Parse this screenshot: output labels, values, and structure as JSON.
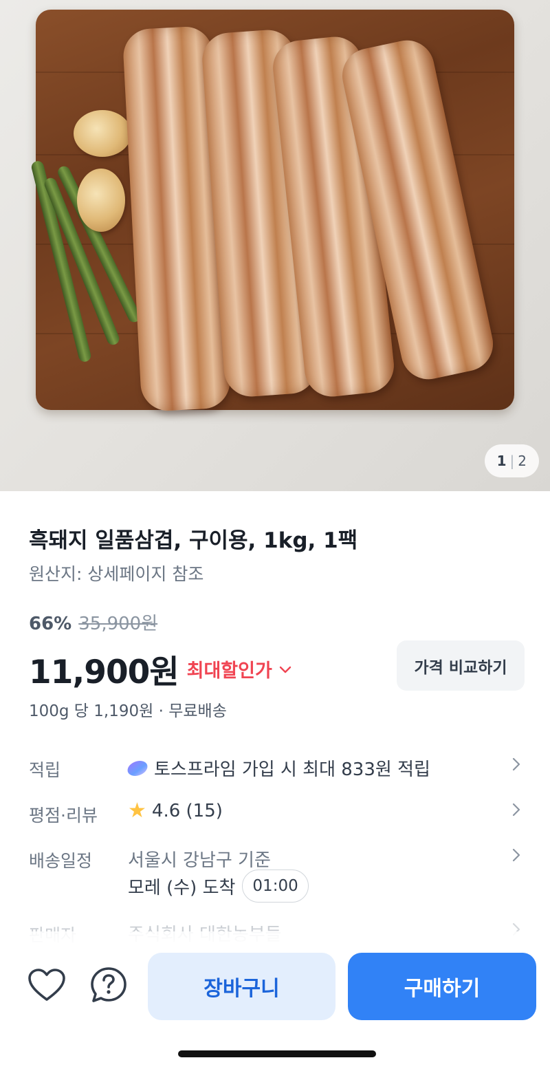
{
  "gallery": {
    "image_description_icon": "pork-belly-photo",
    "current": "1",
    "separator": "|",
    "total": "2"
  },
  "product": {
    "title": "흑돼지 일품삼겹, 구이용, 1kg, 1팩",
    "origin": "원산지: 상세페이지 참조",
    "discount_rate": "66%",
    "original_price": "35,900원",
    "price": "11,900원",
    "price_tag": "최대할인가",
    "compare_label": "가격 비교하기",
    "unit_price": "100g 당 1,190원 · 무료배송"
  },
  "details": {
    "points": {
      "label": "적립",
      "value": "토스프라임 가입 시 최대 833원 적립",
      "icon": "toss-prime-icon"
    },
    "rating": {
      "label": "평점·리뷰",
      "value": "4.6 (15)",
      "icon": "star-icon"
    },
    "delivery": {
      "label": "배송일정",
      "line1": "서울시 강남구 기준",
      "line2": "모레 (수) 도착",
      "timer": "01:00"
    },
    "seller": {
      "label": "판매자",
      "value": "주식회사 대한농부들"
    }
  },
  "actions": {
    "cart_label": "장바구니",
    "buy_label": "구매하기",
    "wishlist_icon": "heart-icon",
    "inquiry_icon": "question-icon"
  },
  "colors": {
    "primary": "#3182f6",
    "primary_light": "#e3eefd",
    "sale_red": "#f04452",
    "star": "#ffc342"
  }
}
